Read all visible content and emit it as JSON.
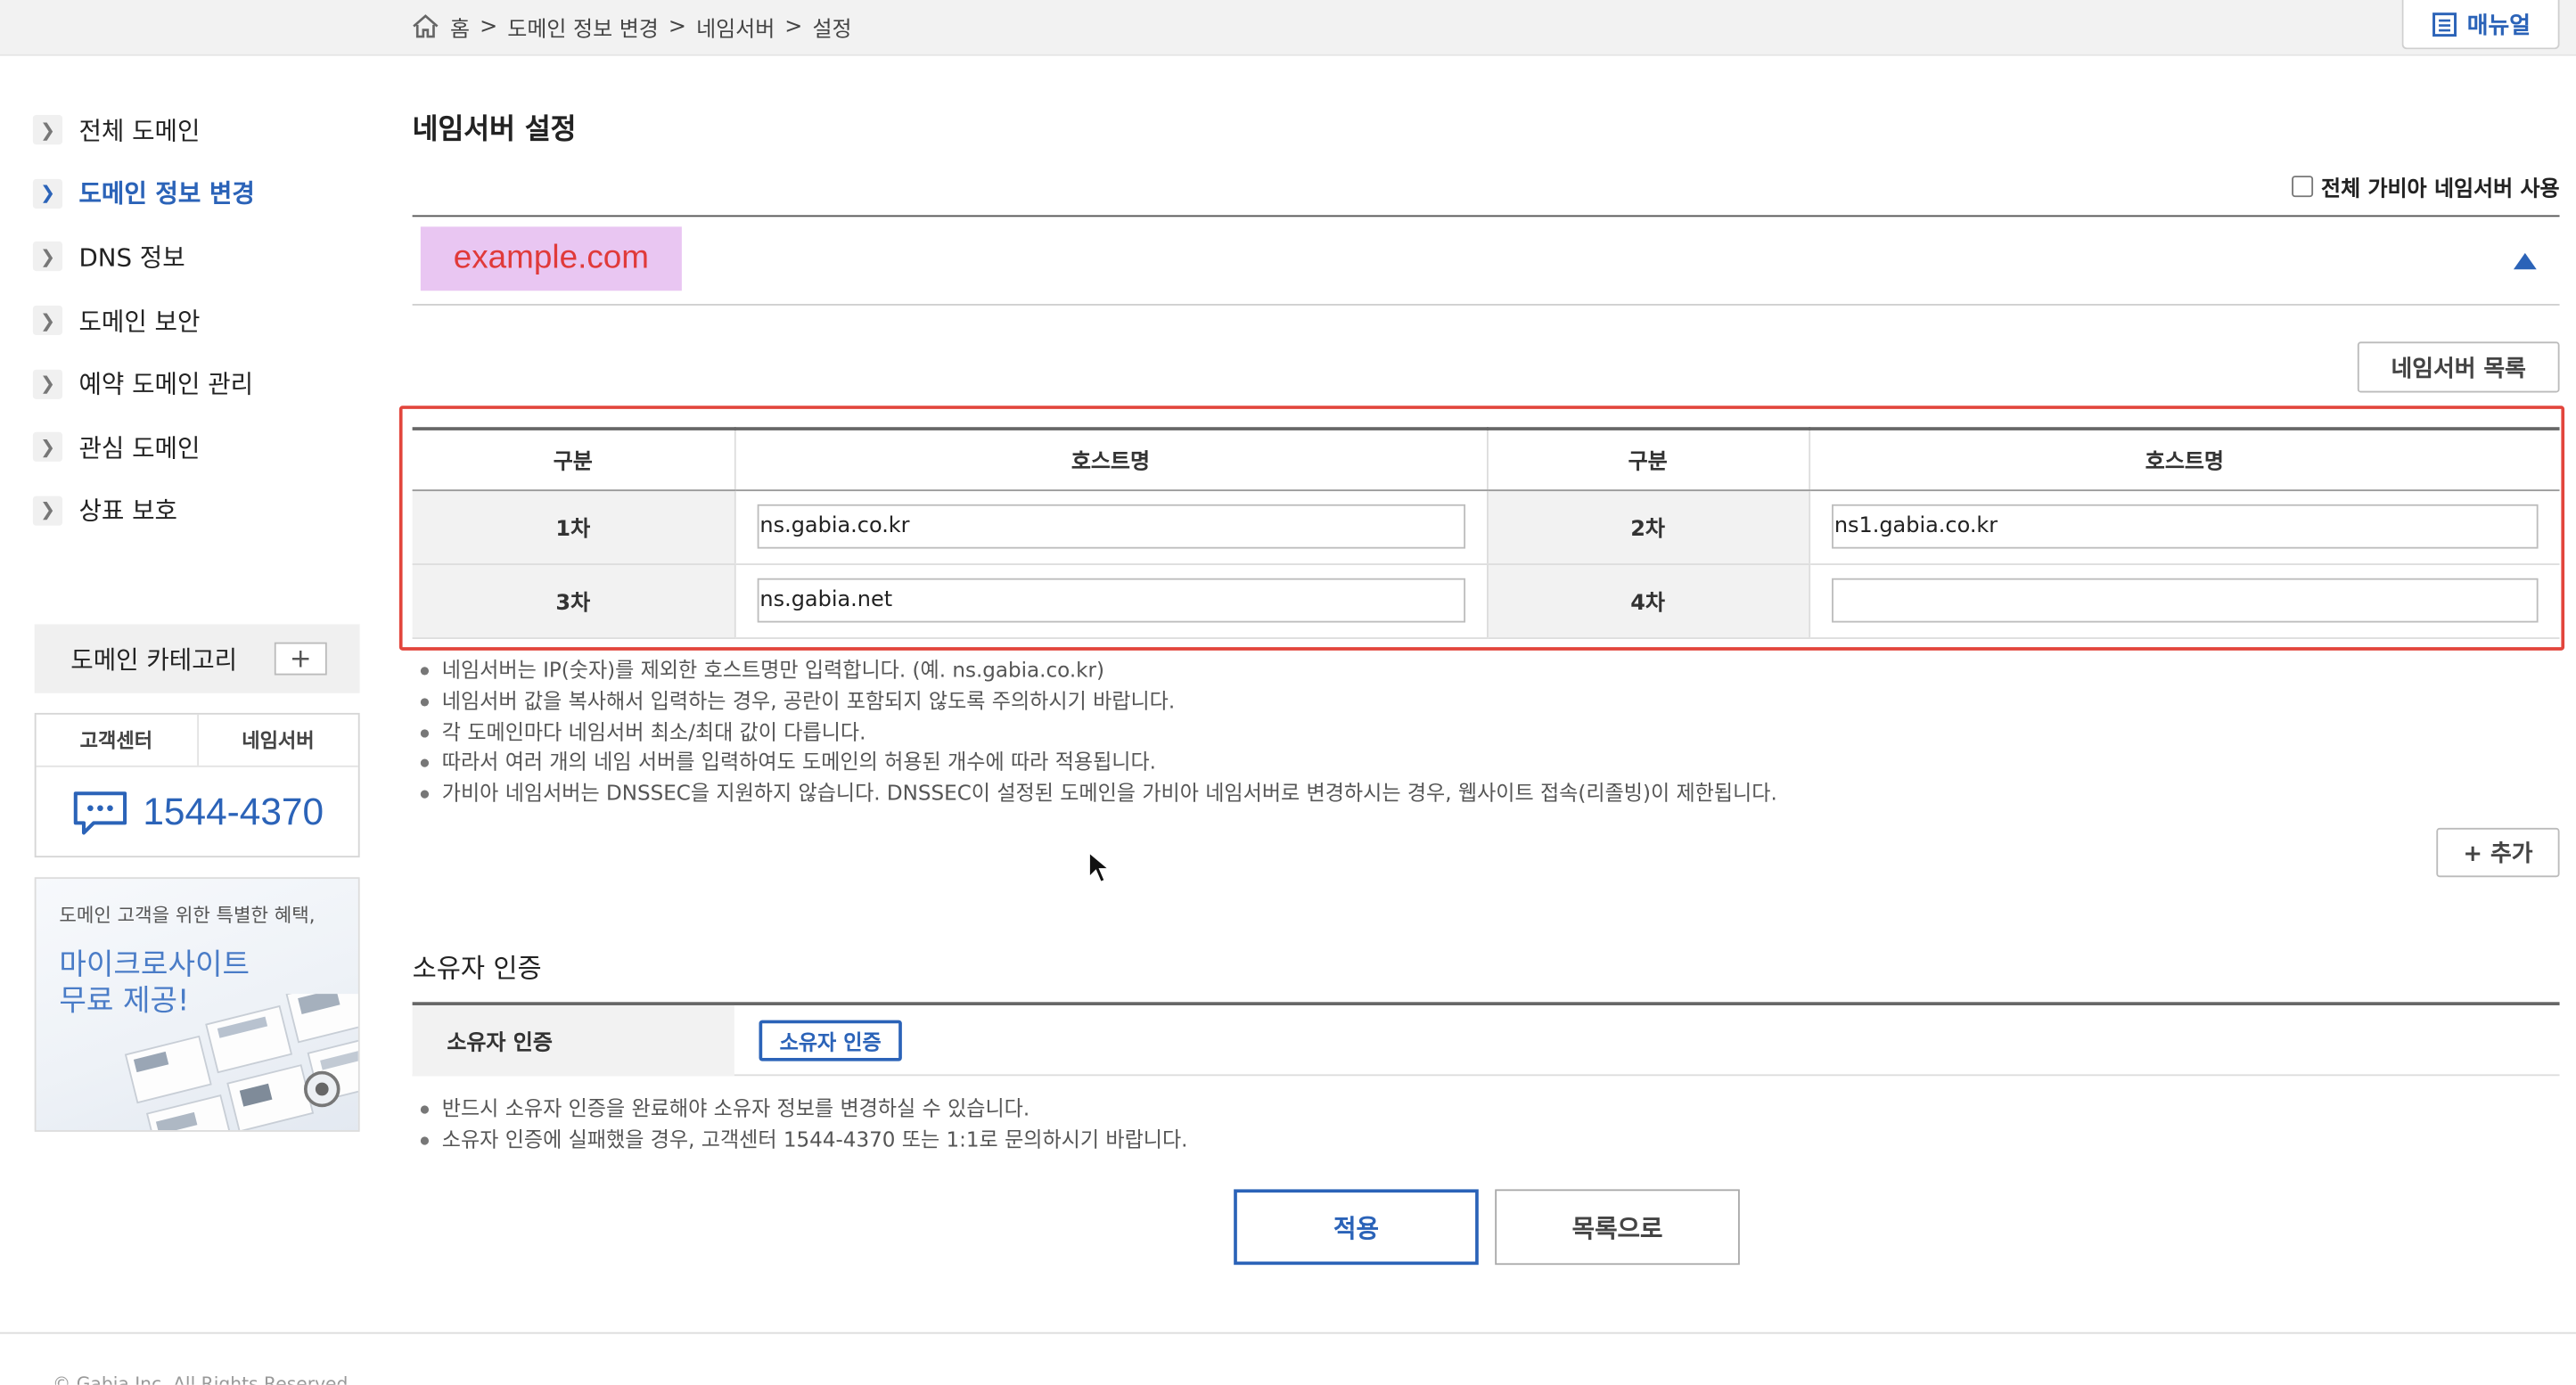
{
  "breadcrumb": {
    "items": [
      "홈",
      "도메인 정보 변경",
      "네임서버",
      "설정"
    ],
    "separator": ">"
  },
  "manual": {
    "label": "매뉴얼"
  },
  "sidebar": {
    "items": [
      {
        "label": "전체 도메인",
        "active": false
      },
      {
        "label": "도메인 정보 변경",
        "active": true
      },
      {
        "label": "DNS 정보",
        "active": false
      },
      {
        "label": "도메인 보안",
        "active": false
      },
      {
        "label": "예약 도메인 관리",
        "active": false
      },
      {
        "label": "관심 도메인",
        "active": false
      },
      {
        "label": "상표 보호",
        "active": false
      }
    ],
    "category": {
      "label": "도메인 카테고리",
      "add_symbol": "+"
    },
    "support": {
      "tabs": [
        "고객센터",
        "네임서버"
      ],
      "phone": "1544-4370"
    },
    "promo": {
      "subtitle": "도메인 고객을 위한 특별한 혜택,",
      "title_line1": "마이크로사이트",
      "title_line2": "무료 제공!"
    }
  },
  "main": {
    "title": "네임서버 설정",
    "use_all_label": "전체 가비아 네임서버 사용",
    "domain": "example.com",
    "ns_list_button": "네임서버 목록",
    "table": {
      "headers": [
        "구분",
        "호스트명",
        "구분",
        "호스트명"
      ],
      "rows": [
        [
          {
            "label": "1차",
            "value": "ns.gabia.co.kr"
          },
          {
            "label": "2차",
            "value": "ns1.gabia.co.kr"
          }
        ],
        [
          {
            "label": "3차",
            "value": "ns.gabia.net"
          },
          {
            "label": "4차",
            "value": ""
          }
        ]
      ]
    },
    "notes": [
      "네임서버는 IP(숫자)를 제외한 호스트명만 입력합니다. (예. ns.gabia.co.kr)",
      "네임서버 값을 복사해서 입력하는 경우, 공란이 포함되지 않도록 주의하시기 바랍니다.",
      "각 도메인마다 네임서버 최소/최대 값이 다릅니다.",
      "따라서 여러 개의 네임 서버를 입력하여도 도메인의 허용된 개수에 따라 적용됩니다.",
      "가비아 네임서버는 DNSSEC을 지원하지 않습니다. DNSSEC이 설정된 도메인을 가비아 네임서버로 변경하시는 경우, 웹사이트 접속(리졸빙)이 제한됩니다."
    ],
    "add_button": "+ 추가",
    "owner": {
      "section_title": "소유자 인증",
      "row_label": "소유자 인증",
      "button": "소유자 인증",
      "notes": [
        "반드시 소유자 인증을 완료해야 소유자 정보를 변경하실 수 있습니다.",
        "소유자 인증에 실패했을 경우, 고객센터 1544-4370 또는 1:1로 문의하시기 바랍니다."
      ]
    },
    "apply_button": "적용",
    "list_button": "목록으로"
  },
  "footer": {
    "copyright": "© Gabia Inc. All Rights Reserved."
  },
  "colors": {
    "accent": "#2b63b8",
    "highlight_bg": "#e9c6f2",
    "highlight_text": "#e03a3a",
    "frame": "#e2453c"
  }
}
